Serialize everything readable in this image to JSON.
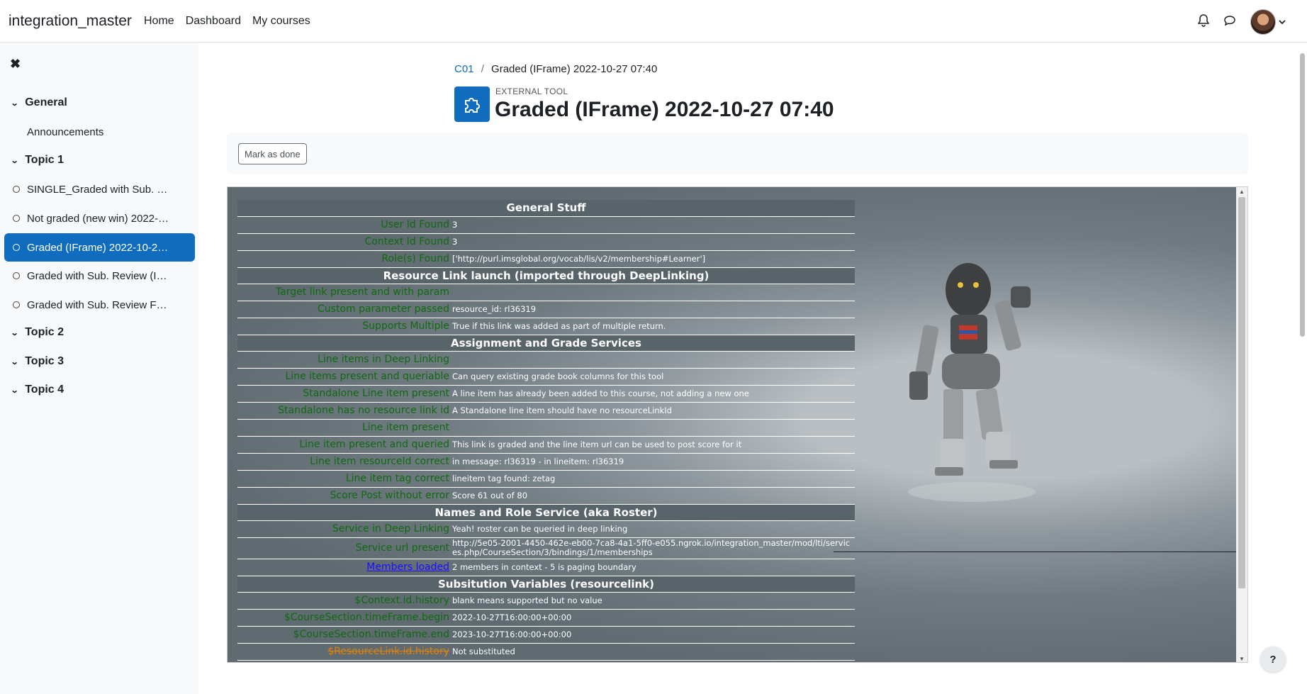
{
  "app": {
    "brand": "integration_master"
  },
  "nav": {
    "links": [
      "Home",
      "Dashboard",
      "My courses"
    ]
  },
  "drawer": {
    "sections": [
      "General",
      "Topic 1",
      "Topic 2",
      "Topic 3",
      "Topic 4"
    ],
    "items": [
      "Announcements",
      "SINGLE_Graded with Sub. …",
      "Not graded (new win) 2022-…",
      "Graded (IFrame) 2022-10-2…",
      "Graded with Sub. Review (I…",
      "Graded with Sub. Review F…"
    ]
  },
  "breadcrumb": {
    "course": "C01",
    "sep": "/",
    "current": "Graded (IFrame) 2022-10-27 07:40"
  },
  "module": {
    "type": "EXTERNAL TOOL",
    "title": "Graded (IFrame) 2022-10-27 07:40",
    "icon": "puzzle-icon"
  },
  "actions": {
    "mark_done": "Mark as done"
  },
  "lti": {
    "h1": "General Stuff",
    "r1": {
      "k": "User Id Found",
      "v": "3"
    },
    "r2": {
      "k": "Context Id Found",
      "v": "3"
    },
    "r3": {
      "k": "Role(s) Found",
      "v": "['http://purl.imsglobal.org/vocab/lis/v2/membership#Learner']"
    },
    "h2": "Resource Link launch (imported through DeepLinking)",
    "r4": {
      "k": "Target link present and with param",
      "v": ""
    },
    "r5": {
      "k": "Custom parameter passed",
      "v": "resource_id: rl36319"
    },
    "r6": {
      "k": "Supports Multiple",
      "v": "True if this link was added as part of multiple return."
    },
    "h3": "Assignment and Grade Services",
    "r7": {
      "k": "Line items in Deep Linking",
      "v": ""
    },
    "r8": {
      "k": "Line items present and queriable",
      "v": "Can query existing grade book columns for this tool"
    },
    "r9": {
      "k": "Standalone Line item present",
      "v": "A line item has already been added to this course, not adding a new one"
    },
    "r10": {
      "k": "Standalone has no resource link id",
      "v": "A Standalone line item should have no resourceLinkId"
    },
    "r11": {
      "k": "Line item present",
      "v": ""
    },
    "r12": {
      "k": "Line item present and queried",
      "v": "This link is graded and the line item url can be used to post score for it"
    },
    "r13": {
      "k": "Line item resourceId correct",
      "v": "in message: rl36319 - in lineitem: rl36319"
    },
    "r14": {
      "k": "Line item tag correct",
      "v": "lineitem tag found: zetag"
    },
    "r15": {
      "k": "Score Post without error",
      "v": "Score 61 out of 80"
    },
    "h4": "Names and Role Service (aka Roster)",
    "r16": {
      "k": "Service in Deep Linking",
      "v": "Yeah! roster can be queried in deep linking"
    },
    "r17": {
      "k": "Service url present",
      "v": "http://5e05-2001-4450-462e-eb00-7ca8-4a1-5ff0-e055.ngrok.io/integration_master/mod/lti/services.php/CourseSection/3/bindings/1/memberships"
    },
    "r18": {
      "k": "Members loaded",
      "v": "2 members in context - 5 is paging boundary"
    },
    "h5": "Subsitution Variables (resourcelink)",
    "r19": {
      "k": "$Context.id.history",
      "v": "blank means supported but no value"
    },
    "r20": {
      "k": "$CourseSection.timeFrame.begin",
      "v": "2022-10-27T16:00:00+00:00"
    },
    "r21": {
      "k": "$CourseSection.timeFrame.end",
      "v": "2023-10-27T16:00:00+00:00"
    },
    "r22": {
      "k": "$ResourceLink.id.history",
      "v": "Not substituted"
    }
  },
  "help": {
    "label": "?"
  },
  "colors": {
    "primary": "#0f6cbf",
    "ok": "#0e6b0e",
    "warn": "#e0820a",
    "header": "#58636a"
  }
}
